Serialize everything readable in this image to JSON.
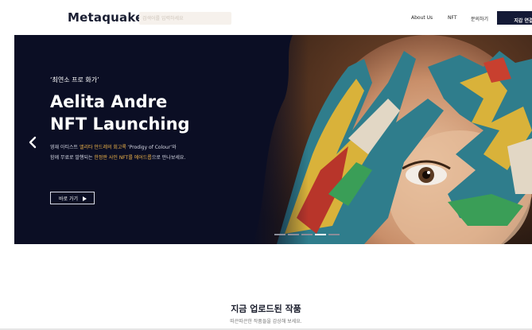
{
  "header": {
    "logo": "Metaquake",
    "search_placeholder": "검색어를 입력하세요",
    "nav": [
      "About Us",
      "NFT",
      "문의하기"
    ],
    "wallet_button": "지갑 연결"
  },
  "hero": {
    "kicker": "‘최연소 프로 화가’",
    "title_line1": "Aelita Andre",
    "title_line2": "NFT Launching",
    "desc_1a": "영재 아티스트 ",
    "desc_1b": "엘리타 안드레의 회고록",
    "desc_1c": " ‘Prodigy of Colour’와",
    "desc_2a": "함께 무료로 발행되는 ",
    "desc_2b": "한정판 사인 NFT를 에어드롭",
    "desc_2c": "으로 만나보세요.",
    "cta_label": "바로 가기",
    "slide_count": 5,
    "active_slide": 4
  },
  "section": {
    "title": "지금 업로드된 작품",
    "subtitle": "따끈따끈한 작품들을 감상해 보세요."
  },
  "colors": {
    "hero_bg": "#0b0e24",
    "highlight": "#f0b54a",
    "button_dark": "#141a36"
  },
  "icons": [
    "chevron-left-icon",
    "play-triangle-icon"
  ]
}
